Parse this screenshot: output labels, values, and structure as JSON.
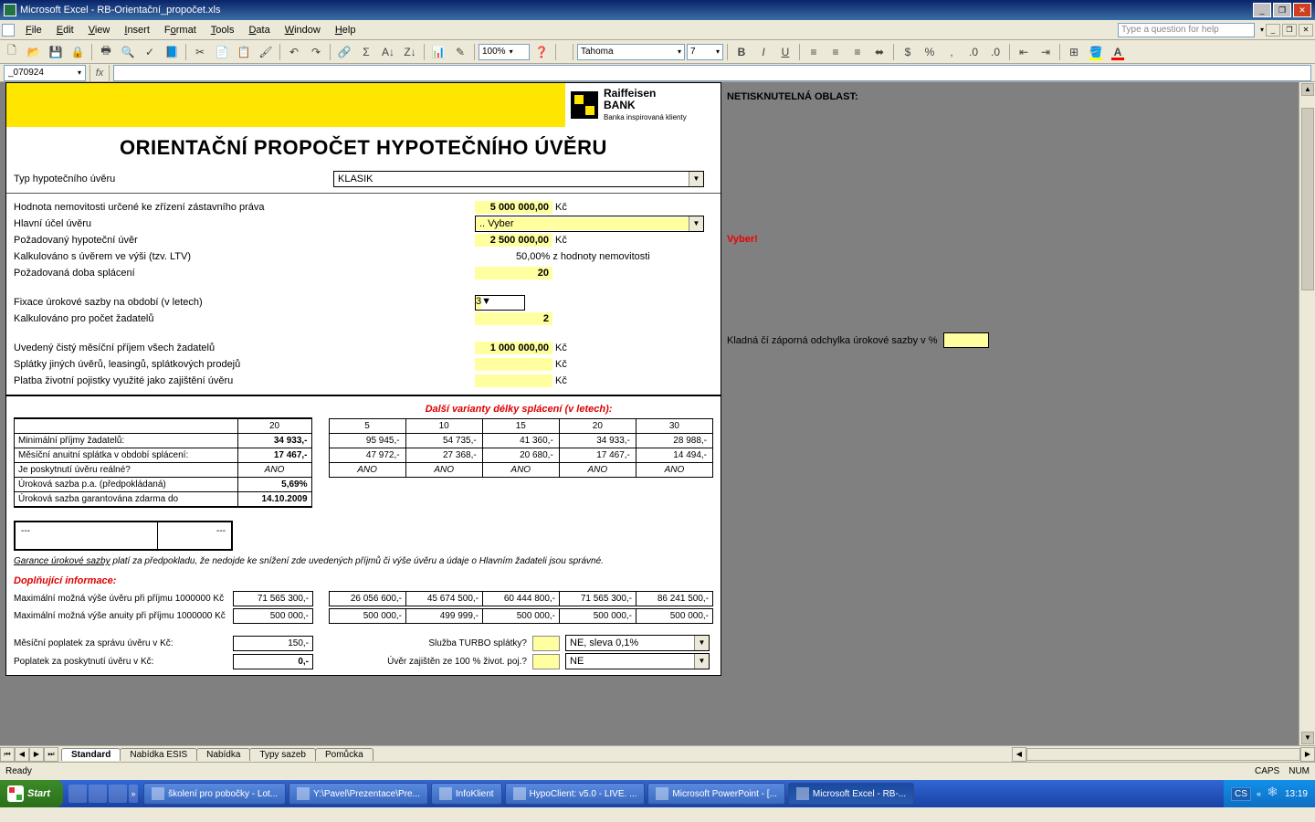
{
  "app_title": "Microsoft Excel - RB-Orientační_propočet.xls",
  "menu": {
    "file": "File",
    "edit": "Edit",
    "view": "View",
    "insert": "Insert",
    "format": "Format",
    "tools": "Tools",
    "data": "Data",
    "window": "Window",
    "help": "Help"
  },
  "help_placeholder": "Type a question for help",
  "toolbar": {
    "zoom": "100%",
    "font": "Tahoma",
    "size": "7"
  },
  "namebox": "_070924",
  "gray": {
    "hdr": "NETISKNUTELNÁ OBLAST:",
    "vyber": "Vyber!",
    "odchylka": "Kladná čí záporná odchylka úrokové sazby v %"
  },
  "logo": {
    "l1": "Raiffeisen",
    "l2": "BANK",
    "l3": "Banka inspirovaná klienty"
  },
  "title": "ORIENTAČNÍ PROPOČET HYPOTEČNÍHO ÚVĚRU",
  "typ": {
    "lbl": "Typ hypotečního úvěru",
    "val": "KLASIK"
  },
  "hodnota": {
    "lbl": "Hodnota nemovitosti určené ke zřízení zástavního práva",
    "val": "5 000 000,00",
    "kc": "Kč"
  },
  "ucel": {
    "lbl": "Hlavní účel úvěru",
    "val": ".. Vyber"
  },
  "pozuver": {
    "lbl": "Požadovaný hypoteční úvěr",
    "val": "2 500 000,00",
    "kc": "Kč"
  },
  "ltv": {
    "lbl": "Kalkulováno s úvěrem ve výši (tzv. LTV)",
    "val": "50,00% z hodnoty nemovitosti"
  },
  "doba": {
    "lbl": "Požadovaná doba splácení",
    "val": "20"
  },
  "fixace": {
    "lbl": "Fixace úrokové sazby na období (v letech)",
    "val": "3"
  },
  "zadatele": {
    "lbl": "Kalkulováno pro počet žadatelů",
    "val": "2"
  },
  "prijem": {
    "lbl": "Uvedený čistý měsíční příjem všech žadatelů",
    "val": "1 000 000,00",
    "kc": "Kč"
  },
  "splatky": {
    "lbl": "Splátky jiných úvěrů, leasingů, splátkových prodejů",
    "kc": "Kč"
  },
  "pojistka": {
    "lbl": "Platba životní pojistky využité jako zajištění úvěru",
    "kc": "Kč"
  },
  "varianty_lbl": "Další varianty délky splácení (v letech):",
  "left": {
    "hdr": "20",
    "r1": "Minimální příjmy žadatelů:",
    "v1": "34 933,-",
    "r2": "Měsíční anuitní splátka v období splácení:",
    "v2": "17 467,-",
    "r3": "Je poskytnutí úvěru reálné?",
    "v3": "ANO",
    "r4": "Úroková sazba p.a. (předpokládaná)",
    "v4": "5,69%",
    "r5": "Úroková sazba garantována zdarma do",
    "v5": "14.10.2009"
  },
  "variants": {
    "headers": [
      "5",
      "10",
      "15",
      "20",
      "30"
    ],
    "min": [
      "95 945,-",
      "54 735,-",
      "41 360,-",
      "34 933,-",
      "28 988,-"
    ],
    "spl": [
      "47 972,-",
      "27 368,-",
      "20 680,-",
      "17 467,-",
      "14 494,-"
    ],
    "ano": [
      "ANO",
      "ANO",
      "ANO",
      "ANO",
      "ANO"
    ]
  },
  "boxleft": "---",
  "boxright": "---",
  "garance": "Garance úrokové sazby platí za předpokladu, že nedojde ke snížení zde uvedených příjmů či výše úvěru a údaje o Hlavním žadateli jsou správné.",
  "dopl_lbl": "Doplňující informace:",
  "maxuver": {
    "lbl": "Maximální možná výše úvěru při příjmu 1000000 Kč",
    "main": "71 565 300,-",
    "cols": [
      "26 056 600,-",
      "45 674 500,-",
      "60 444 800,-",
      "71 565 300,-",
      "86 241 500,-"
    ]
  },
  "maxanuit": {
    "lbl": "Maximální možná výše anuity při příjmu 1000000 Kč",
    "main": "500 000,-",
    "cols": [
      "500 000,-",
      "499 999,-",
      "500 000,-",
      "500 000,-",
      "500 000,-"
    ]
  },
  "poplatek": {
    "lbl": "Měsíční poplatek za správu úvěru v Kč:",
    "val": "150,-"
  },
  "poplatek2": {
    "lbl": "Poplatek za poskytnutí úvěru v Kč:",
    "val": "0,-"
  },
  "turbo": {
    "lbl": "Služba TURBO splátky?",
    "val": "NE, sleva 0,1%"
  },
  "zivot": {
    "lbl": "Úvěr zajištěn ze 100 % život. poj.?",
    "val": "NE"
  },
  "tabs": [
    "Standard",
    "Nabídka ESIS",
    "Nabídka",
    "Typy sazeb",
    "Pomůcka"
  ],
  "status": {
    "ready": "Ready",
    "caps": "CAPS",
    "num": "NUM"
  },
  "taskbar": {
    "start": "Start",
    "btns": [
      "školení pro pobočky - Lot...",
      "Y:\\Pavel\\Prezentace\\Pre...",
      "InfoKlient",
      "HypoClient: v5.0 - LIVE. ...",
      "Microsoft PowerPoint - [...",
      "Microsoft Excel - RB-..."
    ],
    "lang": "CS",
    "time": "13:19"
  }
}
